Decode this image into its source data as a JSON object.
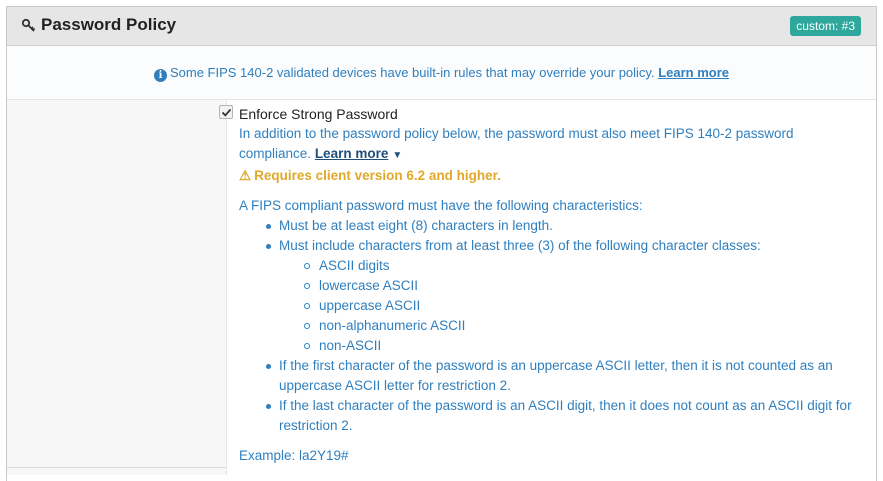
{
  "header": {
    "title": "Password Policy",
    "badge": "custom: #3"
  },
  "info_bar": {
    "text": "Some FIPS 140-2 validated devices have built-in rules that may override your policy.",
    "link": "Learn more"
  },
  "enforce": {
    "label": "Enforce Strong Password",
    "checked": true,
    "description": "In addition to the password policy below, the password must also meet FIPS 140-2 password compliance.",
    "learn_more": "Learn more",
    "warning": "Requires client version 6.2 and higher."
  },
  "characteristics": {
    "intro": "A FIPS compliant password must have the following characteristics:",
    "rule1": "Must be at least eight (8) characters in length.",
    "rule2": "Must include characters from at least three (3) of the following character classes:",
    "classes": [
      "ASCII digits",
      "lowercase ASCII",
      "uppercase ASCII",
      "non-alphanumeric ASCII",
      "non-ASCII"
    ],
    "rule3": "If the first character of the password is an uppercase ASCII letter, then it is not counted as an uppercase ASCII letter for restriction 2.",
    "rule4": "If the last character of the password is an ASCII digit, then it does not count as an ASCII digit for restriction 2.",
    "example": "Example: la2Y19#"
  },
  "colors": {
    "badge": "#2ea89d",
    "info": "#2f7fbf",
    "warning": "#e0a92a"
  }
}
